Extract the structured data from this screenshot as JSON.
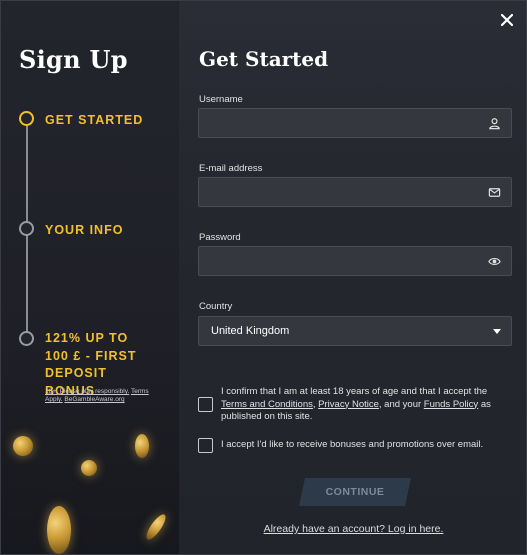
{
  "left_panel": {
    "title": "Sign Up",
    "steps": [
      {
        "label": "GET STARTED"
      },
      {
        "label": "YOUR INFO"
      },
      {
        "label": "121% UP TO 100 £ - FIRST DEPOSIT BONUS"
      }
    ],
    "disclaimer": {
      "age": "18+.",
      "play_responsibly": "Please play responsibly.",
      "terms": "Terms Apply.",
      "begambleaware": "BeGambleAware.org"
    }
  },
  "form": {
    "title": "Get Started",
    "username": {
      "label": "Username",
      "value": "",
      "icon": "user-icon"
    },
    "email": {
      "label": "E-mail address",
      "value": "",
      "icon": "envelope-icon"
    },
    "password": {
      "label": "Password",
      "value": "",
      "icon": "eye-icon"
    },
    "country": {
      "label": "Country",
      "selected": "United Kingdom"
    },
    "consent_age": {
      "text_prefix": "I confirm that I am at least 18 years of age and that I accept the",
      "terms_link": "Terms and Conditions",
      "sep": ",",
      "privacy_link": "Privacy Notice",
      "and_your": ", and your",
      "funds_link": "Funds Policy",
      "suffix": "as published on this site.",
      "checked": false
    },
    "consent_promo": {
      "text": "I accept I'd like to receive bonuses and promotions over email.",
      "checked": false
    },
    "continue_label": "CONTINUE",
    "login_link": "Already have an account? Log in here."
  },
  "colors": {
    "accent": "#f1c12b",
    "button_bg": "#2c3a4a",
    "input_bg": "#35373f"
  }
}
